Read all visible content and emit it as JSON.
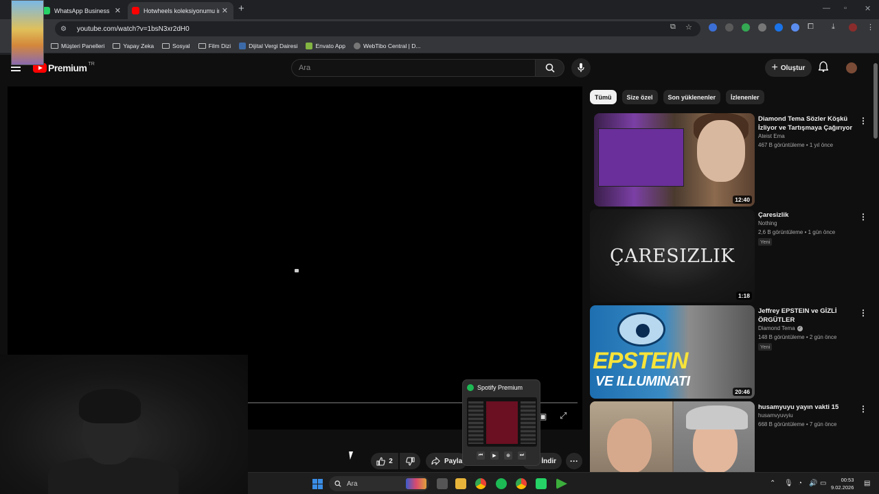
{
  "browser": {
    "tabs": [
      {
        "label": "WhatsApp Business",
        "color": "#25d366"
      },
      {
        "label": "Hotwheels koleksiyonumu incel",
        "color": "#ff0000",
        "active": true
      }
    ],
    "url": "youtube.com/watch?v=1bsN3xr2dH0",
    "bookmarks": [
      {
        "label": "Müşteri Panelleri",
        "icon": "folder-icon"
      },
      {
        "label": "Yapay Zeka",
        "icon": "folder-icon"
      },
      {
        "label": "Sosyal",
        "icon": "folder-icon"
      },
      {
        "label": "Film Dizi",
        "icon": "folder-icon"
      },
      {
        "label": "Dijital Vergi Dairesi",
        "icon": "site-icon"
      },
      {
        "label": "Envato App",
        "icon": "site-icon"
      },
      {
        "label": "WebTibo Central | D...",
        "icon": "site-icon"
      }
    ]
  },
  "youtube": {
    "logo_text": "Premium",
    "logo_region": "TR",
    "search_placeholder": "Ara",
    "create_label": "Oluştur",
    "actions": {
      "like_count": "2",
      "share_label": "Paylaş",
      "download_label": "İndir"
    },
    "chips": [
      "Tümü",
      "Size özel",
      "Son yüklenenler",
      "İzlenenler"
    ],
    "recommendations": [
      {
        "title": "Diamond Tema Sözler Köşkü İzliyor ve Tartışmaya Çağırıyor",
        "channel": "Ateist Ema",
        "meta": "467 B görüntüleme • 1 yıl önce",
        "duration": "12:40",
        "badge": ""
      },
      {
        "title": "Çaresizlik",
        "channel": "Nothing",
        "meta": "2,6 B görüntüleme • 1 gün önce",
        "duration": "1:18",
        "badge": "Yeni",
        "thumb_text": "ÇARESIZLIK"
      },
      {
        "title": "Jeffrey EPSTEIN ve GİZLİ ÖRGÜTLER",
        "channel": "Diamond Tema",
        "meta": "148 B görüntüleme • 2 gün önce",
        "duration": "20:46",
        "badge": "Yeni",
        "thumb_text_1": "EPSTEIN",
        "thumb_text_2": "VE ILLUMINATI"
      },
      {
        "title": "husamyuyu yayın vakti 15",
        "channel": "husamvyuvyiu",
        "meta": "668 B görüntüleme • 7 gün önce",
        "duration": "",
        "badge": ""
      }
    ]
  },
  "spotify_preview": {
    "title": "Spotify Premium"
  },
  "taskbar": {
    "search_placeholder": "Ara",
    "time": "00:53",
    "date": "9.02.2026"
  }
}
